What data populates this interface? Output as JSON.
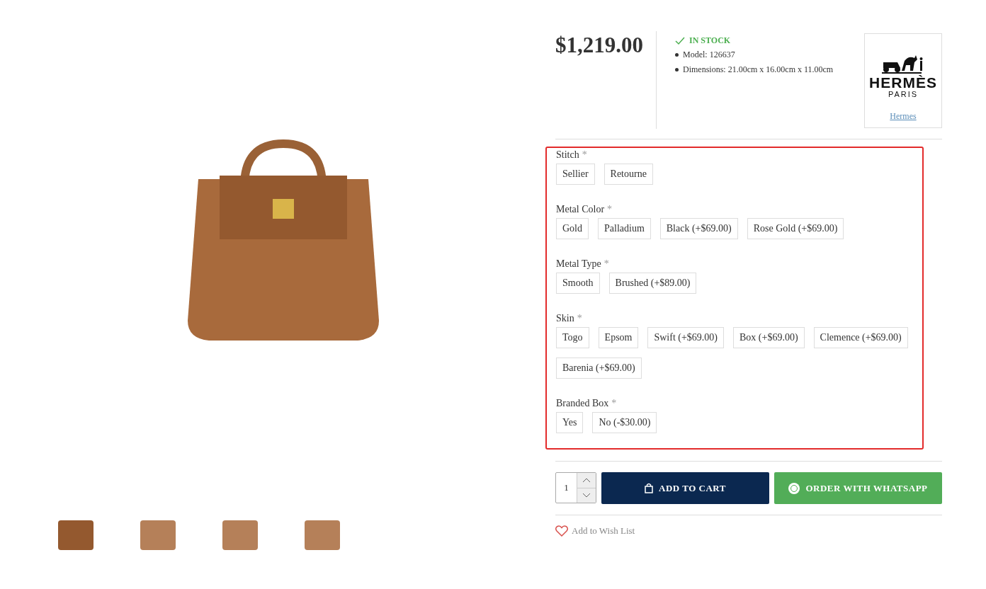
{
  "gallery": {
    "thumbnails": [
      {
        "selected": true
      },
      {
        "selected": false
      },
      {
        "selected": false
      },
      {
        "selected": false
      }
    ]
  },
  "product": {
    "price": "$1,219.00",
    "stock": "IN STOCK",
    "specs": [
      "Model: 126637",
      "Dimensions: 21.00cm x 16.00cm x 11.00cm"
    ],
    "brand": {
      "logo_name": "HERMÈS",
      "logo_city": "PARIS",
      "link": "Hermes"
    }
  },
  "options": [
    {
      "label": "Stitch",
      "required": true,
      "values": [
        "Sellier",
        "Retourne"
      ]
    },
    {
      "label": "Metal Color",
      "required": true,
      "values": [
        "Gold",
        "Palladium",
        "Black (+$69.00)",
        "Rose Gold (+$69.00)"
      ]
    },
    {
      "label": "Metal Type",
      "required": true,
      "values": [
        "Smooth",
        "Brushed (+$89.00)"
      ]
    },
    {
      "label": "Skin",
      "required": true,
      "values": [
        "Togo",
        "Epsom",
        "Swift (+$69.00)",
        "Box (+$69.00)",
        "Clemence (+$69.00)",
        "Barenia (+$69.00)"
      ]
    },
    {
      "label": "Branded Box",
      "required": true,
      "values": [
        "Yes",
        "No (-$30.00)"
      ]
    }
  ],
  "required_mark": "*",
  "purchase": {
    "quantity": "1",
    "add_to_cart": "ADD TO CART",
    "whatsapp": "ORDER WITH WHATSAPP",
    "wishlist": "Add to Wish List"
  }
}
